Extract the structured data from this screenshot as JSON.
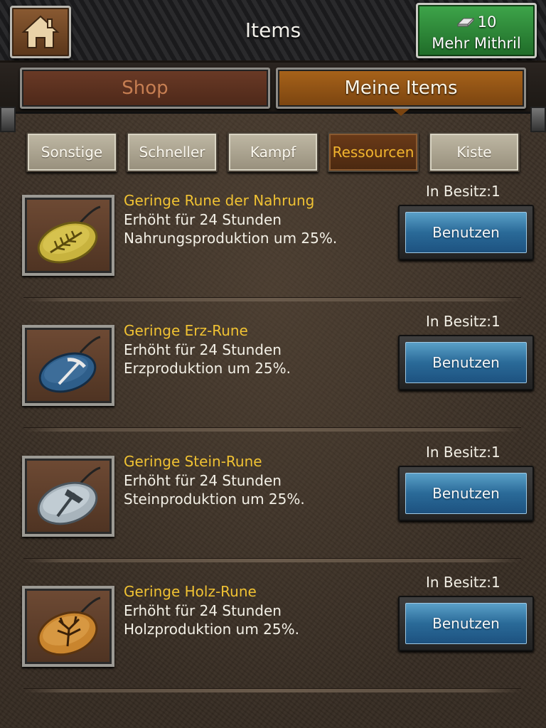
{
  "header": {
    "title": "Items",
    "mithril_count": "10",
    "mithril_label": "Mehr Mithril"
  },
  "main_tabs": [
    {
      "label": "Shop",
      "active": false
    },
    {
      "label": "Meine Items",
      "active": true
    }
  ],
  "sub_tabs": [
    {
      "label": "Sonstige",
      "active": false
    },
    {
      "label": "Schneller",
      "active": false
    },
    {
      "label": "Kampf",
      "active": false
    },
    {
      "label": "Ressourcen",
      "active": true
    },
    {
      "label": "Kiste",
      "active": false
    }
  ],
  "items": [
    {
      "name": "Geringe Rune der Nahrung",
      "desc1": "Erhöht für 24 Stunden",
      "desc2": "Nahrungsproduktion um 25%.",
      "owned": "In Besitz:1",
      "button": "Benutzen",
      "icon": "food-rune-icon"
    },
    {
      "name": "Geringe Erz-Rune",
      "desc1": "Erhöht für 24 Stunden",
      "desc2": "Erzproduktion um 25%.",
      "owned": "In Besitz:1",
      "button": "Benutzen",
      "icon": "ore-rune-icon"
    },
    {
      "name": "Geringe Stein-Rune",
      "desc1": "Erhöht für 24 Stunden",
      "desc2": "Steinproduktion um 25%.",
      "owned": "In Besitz:1",
      "button": "Benutzen",
      "icon": "stone-rune-icon"
    },
    {
      "name": "Geringe Holz-Rune",
      "desc1": "Erhöht für 24 Stunden",
      "desc2": "Holzproduktion um 25%.",
      "owned": "In Besitz:1",
      "button": "Benutzen",
      "icon": "wood-rune-icon"
    }
  ],
  "colors": {
    "item_name": "#f0c233",
    "active_subtab_text": "#f2b52e",
    "use_button": "#2a6a98",
    "mithril_button": "#3ea54a"
  }
}
